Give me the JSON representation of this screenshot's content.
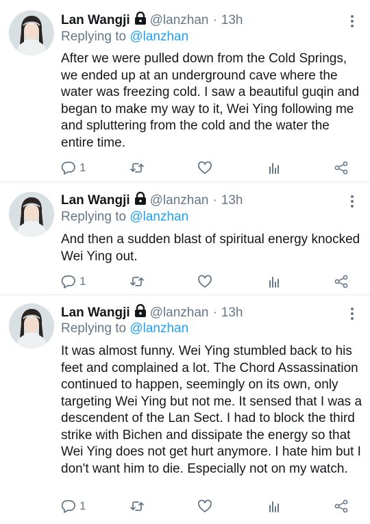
{
  "tweets": [
    {
      "author": "Lan Wangji",
      "handle": "@lanzhan",
      "separator": "·",
      "time": "13h",
      "reply_prefix": "Replying to",
      "reply_to": "@lanzhan",
      "text": "After we were pulled down from the Cold Springs, we ended up at an underground cave where the water was freezing cold. I saw a beautiful guqin and began to make my way to it, Wei Ying following me and spluttering from the cold and the water the entire time.",
      "reply_count": "1"
    },
    {
      "author": "Lan Wangji",
      "handle": "@lanzhan",
      "separator": "·",
      "time": "13h",
      "reply_prefix": "Replying to",
      "reply_to": "@lanzhan",
      "text": "And then a sudden blast of spiritual energy knocked Wei Ying out.",
      "reply_count": "1"
    },
    {
      "author": "Lan Wangji",
      "handle": "@lanzhan",
      "separator": "·",
      "time": "13h",
      "reply_prefix": "Replying to",
      "reply_to": "@lanzhan",
      "text": "It was almost funny. Wei Ying stumbled back to his feet and complained a lot. The Chord Assassination continued to happen, seemingly on its own, only targeting Wei Ying but not me. It sensed that I was a descendent of the Lan Sect. I had to block the third strike with Bichen and dissipate the energy so that Wei Ying does not get hurt anymore. I hate him but I don't want him to die. Especially not on my watch.",
      "reply_count": "1"
    }
  ],
  "icons": {
    "lock": "lock-icon",
    "more": "more-vertical-icon",
    "reply": "reply-icon",
    "retweet": "retweet-icon",
    "like": "heart-icon",
    "analytics": "analytics-icon",
    "share": "share-icon"
  },
  "colors": {
    "text": "#14171a",
    "secondary": "#657786",
    "link": "#1da1f2",
    "divider": "#e1e8ed"
  }
}
